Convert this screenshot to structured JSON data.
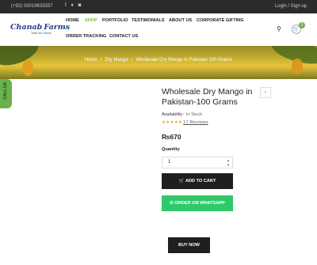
{
  "topbar": {
    "phone": "(+92) 03019633337",
    "auth": "Login / Sign up"
  },
  "brand": {
    "name_a": "Chanab",
    "name_b": "Farms",
    "tagline": "Taste the Nature"
  },
  "nav": {
    "home": "HOME",
    "shop": "SHOP",
    "portfolio": "PORTFOLIO",
    "testimonials": "TESTIMONIALS",
    "about": "ABOUT US",
    "corporate": "CORPORATE GIFTING",
    "tracking": "ORDER TRACKING",
    "contact": "CONTACT US"
  },
  "cart": {
    "count": "0"
  },
  "breadcrumb": {
    "home": "Home",
    "category": "Dry Mango",
    "current": "Wholesale Dry Mango in Pakistan-100 Grams"
  },
  "call_us": "CALL US",
  "product": {
    "title": "Wholesale Dry Mango in Pakistan-100 Grams",
    "availability_label": "Availability:",
    "availability_value": "In Stock",
    "rating": 5,
    "reviews": "17 Reviews",
    "price": "₨670",
    "quantity_label": "Quantity",
    "quantity": "1",
    "add_to_cart": "ADD TO CART",
    "whatsapp": "ORDER ON WHATSAPP",
    "buy_now": "BUY NOW"
  },
  "colors": {
    "accent": "#6ab04c",
    "whatsapp": "#2fc96a",
    "dark": "#1f1f1f"
  }
}
